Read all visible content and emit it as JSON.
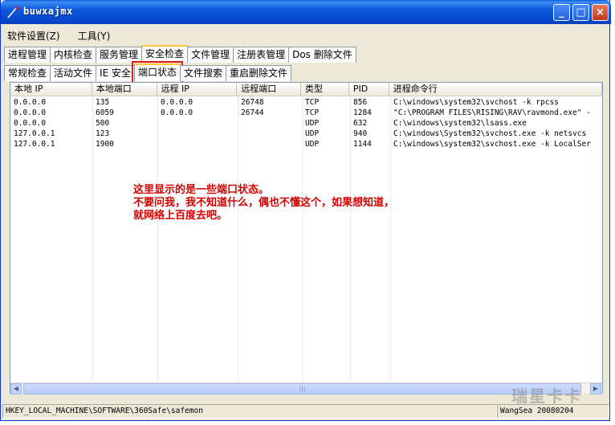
{
  "window": {
    "title": "buwxajmx",
    "minimize": "_",
    "maximize": "□",
    "close": "×"
  },
  "menu": [
    "软件设置(Z)",
    "工具(Y)"
  ],
  "tabs_main": [
    "进程管理",
    "内核检查",
    "服务管理",
    "安全检查",
    "文件管理",
    "注册表管理",
    "Dos 删除文件"
  ],
  "tabs_sub": [
    "常规检查",
    "活动文件",
    "IE 安全",
    "端口状态",
    "文件搜索",
    "重启删除文件"
  ],
  "table": {
    "columns": [
      "本地 IP",
      "本地端口",
      "远程 IP",
      "远程端口",
      "类型",
      "PID",
      "进程命令行"
    ],
    "rows": [
      [
        "0.0.0.0",
        "135",
        "0.0.0.0",
        "26748",
        "TCP",
        "856",
        "C:\\windows\\system32\\svchost -k rpcss"
      ],
      [
        "0.0.0.0",
        "6059",
        "0.0.0.0",
        "26744",
        "TCP",
        "1284",
        "\"C:\\PROGRAM FILES\\RISING\\RAV\\ravmond.exe\" -"
      ],
      [
        "0.0.0.0",
        "500",
        "",
        "",
        "UDP",
        "632",
        "C:\\windows\\system32\\lsass.exe"
      ],
      [
        "127.0.0.1",
        "123",
        "",
        "",
        "UDP",
        "940",
        "C:\\windows\\System32\\svchost.exe -k netsvcs"
      ],
      [
        "127.0.0.1",
        "1900",
        "",
        "",
        "UDP",
        "1144",
        "C:\\windows\\system32\\svchost.exe -k LocalSer"
      ]
    ]
  },
  "annotation": [
    "这里显示的是一些端口状态。",
    "不要问我，我不知道什么，偶也不懂这个，如果想知道，",
    "就网络上百度去吧。"
  ],
  "scrollbar": {
    "left": "◀",
    "right": "▶",
    "thumb": "|||"
  },
  "status": {
    "left": "HKEY_LOCAL_MACHINE\\SOFTWARE\\360Safe\\safemon",
    "right": "WangSea 20080204"
  },
  "watermark": "瑞星卡卡",
  "colors": {
    "title_blue": "#0b59dd",
    "highlight_red": "#e01b1b",
    "annotation_red": "#d40000"
  }
}
